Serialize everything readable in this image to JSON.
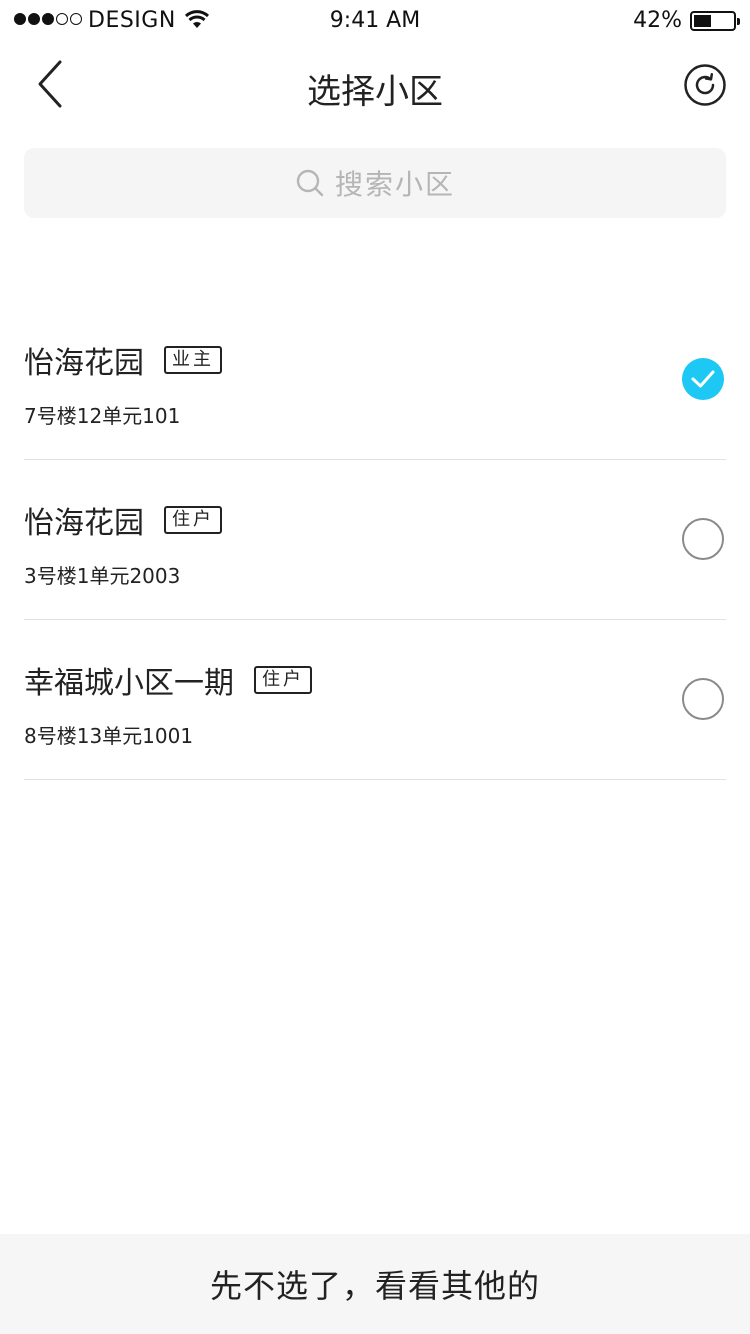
{
  "status_bar": {
    "carrier": "DESIGN",
    "time": "9:41 AM",
    "battery_percent": "42%",
    "battery_level": 0.42,
    "signal_strength": 3,
    "signal_max": 5
  },
  "nav": {
    "title": "选择小区",
    "back_icon": "chevron-left-icon",
    "refresh_icon": "refresh-icon"
  },
  "search": {
    "placeholder": "搜索小区",
    "icon": "search-icon"
  },
  "communities": [
    {
      "name": "怡海花园",
      "role": "业主",
      "address": "7号楼12单元101",
      "selected": true
    },
    {
      "name": "怡海花园",
      "role": "住户",
      "address": "3号楼1单元2003",
      "selected": false
    },
    {
      "name": "幸福城小区一期",
      "role": "住户",
      "address": "8号楼13单元1001",
      "selected": false
    }
  ],
  "bottom_action": {
    "label": "先不选了，看看其他的"
  },
  "colors": {
    "accent": "#1ec8f5",
    "search_bg": "#f5f5f5",
    "bottom_bg": "#f6f6f6",
    "divider": "#e2e2e2"
  }
}
